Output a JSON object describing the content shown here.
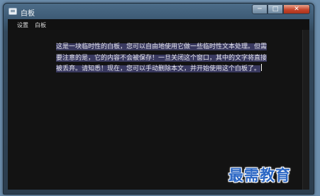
{
  "window": {
    "title": "白板",
    "controls": {
      "minimize": "─",
      "maximize": "□",
      "close": "✕"
    }
  },
  "menu": {
    "items": [
      {
        "label": "设置"
      },
      {
        "label": "白板"
      }
    ]
  },
  "editor": {
    "text": "这是一块临时性的白板，您可以自由地使用它做一些临时性文本处理。但需要注意的是，它的内容不会被保存！一旦关闭这个窗口，其中的文字将直接被丢弃。请知悉！现在，您可以手动删除本文，并开始使用这个白板了。",
    "selected": true
  },
  "watermark": {
    "text": "最需教育"
  },
  "colors": {
    "background": "#131313",
    "selection": "#39395f",
    "text": "#e6e6ef",
    "watermark": "#2a66c4"
  }
}
